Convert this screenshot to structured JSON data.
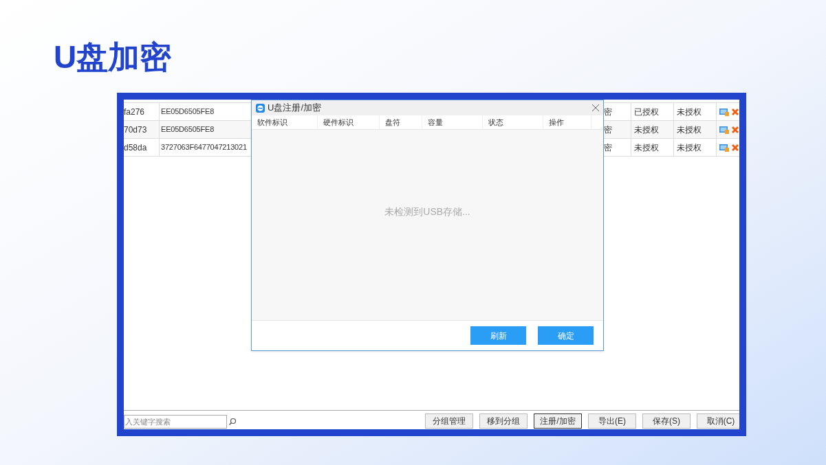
{
  "slide_title": "U盘加密",
  "table": {
    "rows": [
      {
        "left": [
          "fa276",
          "EE05D6505FE8"
        ],
        "right": [
          "密",
          "已授权",
          "未授权"
        ]
      },
      {
        "left": [
          "70d73",
          "EE05D6505FE8"
        ],
        "right": [
          "密",
          "未授权",
          "未授权"
        ]
      },
      {
        "left": [
          "d58da",
          "3727063F6477047213021"
        ],
        "right": [
          "密",
          "未授权",
          "未授权"
        ]
      }
    ]
  },
  "dialog": {
    "title": "U盘注册/加密",
    "columns": [
      "软件标识",
      "硬件标识",
      "盘符",
      "容量",
      "状态",
      "操作"
    ],
    "empty_message": "未检测到USB存储...",
    "buttons": [
      "刷新",
      "确定"
    ]
  },
  "bottom_bar": {
    "search": {
      "placeholder": "入关键字搜索"
    },
    "buttons": [
      {
        "label": "分组管理",
        "focused": false
      },
      {
        "label": "移到分组",
        "focused": false
      },
      {
        "label": "注册/加密",
        "focused": true
      },
      {
        "label": "导出(E)",
        "focused": false
      },
      {
        "label": "保存(S)",
        "focused": false
      },
      {
        "label": "取消(C)",
        "focused": false
      }
    ]
  }
}
